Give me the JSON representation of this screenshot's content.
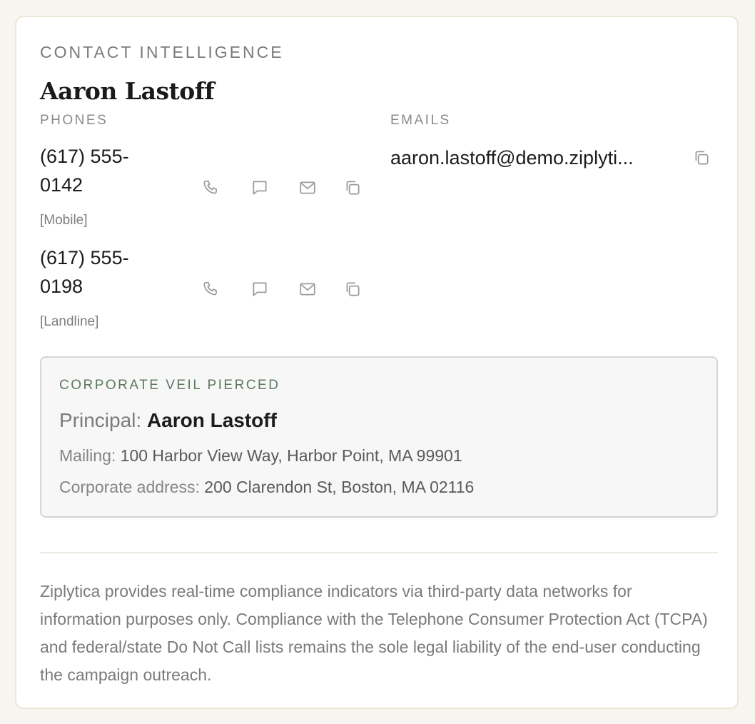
{
  "card": {
    "eyebrow": "CONTACT INTELLIGENCE",
    "name": "Aaron Lastoff"
  },
  "phones": {
    "header": "PHONES",
    "items": [
      {
        "number": "(617) 555-0142",
        "type": "[Mobile]"
      },
      {
        "number": "(617) 555-0198",
        "type": "[Landline]"
      }
    ],
    "actions": [
      "phone-icon",
      "chat-icon",
      "mail-icon",
      "copy-icon"
    ]
  },
  "emails": {
    "header": "EMAILS",
    "items": [
      {
        "address": "aaron.lastoff@demo.ziplyti..."
      }
    ]
  },
  "veil": {
    "title": "CORPORATE VEIL PIERCED",
    "principal_label": "Principal:",
    "principal_name": "Aaron Lastoff",
    "mailing_label": "Mailing:",
    "mailing_value": "100 Harbor View Way, Harbor Point, MA 99901",
    "corporate_label": "Corporate address:",
    "corporate_value": "200 Clarendon St, Boston, MA 02116"
  },
  "disclaimer": "Ziplytica provides real-time compliance indicators via third-party data networks for information purposes only. Compliance with the Telephone Consumer Protection Act (TCPA) and federal/state Do Not Call lists remains the sole legal liability of the end-user conducting the campaign outreach.",
  "colors": {
    "page_bg": "#f7f5ef",
    "card_border": "#ece6d8",
    "veil_title": "#5d7a5e",
    "icon_stroke": "#9a9a9a"
  }
}
